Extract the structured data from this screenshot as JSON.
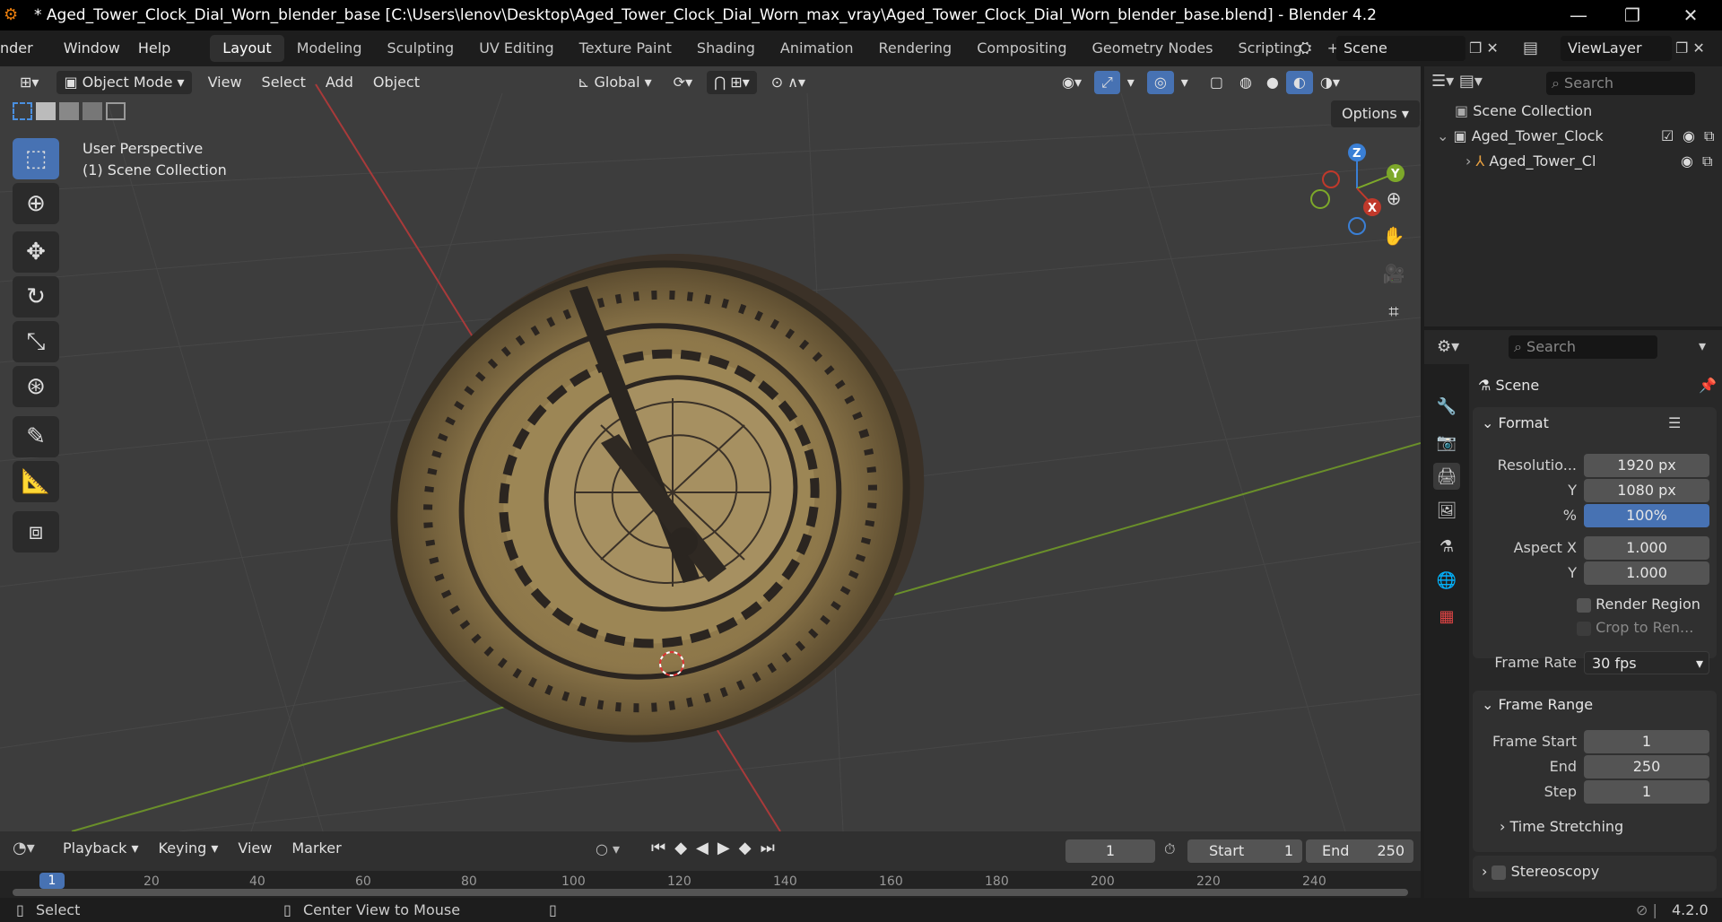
{
  "title_bar": {
    "title": "* Aged_Tower_Clock_Dial_Worn_blender_base [C:\\Users\\lenov\\Desktop\\Aged_Tower_Clock_Dial_Worn_max_vray\\Aged_Tower_Clock_Dial_Worn_blender_base.blend] - Blender 4.2",
    "minimize": "—",
    "maximize": "❐",
    "close": "✕"
  },
  "menu": {
    "items": [
      "nder",
      "Window",
      "Help"
    ],
    "workspaces": [
      "Layout",
      "Modeling",
      "Sculpting",
      "UV Editing",
      "Texture Paint",
      "Shading",
      "Animation",
      "Rendering",
      "Compositing",
      "Geometry Nodes",
      "Scripting"
    ],
    "active_workspace": "Layout",
    "add_tab": "+",
    "scene": "Scene",
    "view_layer": "ViewLayer"
  },
  "viewport": {
    "mode": "Object Mode",
    "menus": [
      "View",
      "Select",
      "Add",
      "Object"
    ],
    "transform_orientation": "Global",
    "options": "Options",
    "info_line1": "User Perspective",
    "info_line2": "(1) Scene Collection",
    "gizmo": {
      "x": "X",
      "y": "Y",
      "z": "Z"
    }
  },
  "outliner": {
    "search_placeholder": "Search",
    "root": "Scene Collection",
    "collection": "Aged_Tower_Clock",
    "object": "Aged_Tower_Cl"
  },
  "properties": {
    "search_placeholder": "Search",
    "context": "Scene",
    "format_panel": "Format",
    "resolution_label": "Resolutio...",
    "resolution_x": "1920 px",
    "y_label": "Y",
    "resolution_y": "1080 px",
    "percent_label": "%",
    "percent": "100%",
    "aspect_x_label": "Aspect X",
    "aspect_x": "1.000",
    "aspect_y_label": "Y",
    "aspect_y": "1.000",
    "render_region": "Render Region",
    "crop": "Crop to Ren...",
    "frame_rate_label": "Frame Rate",
    "frame_rate": "30 fps",
    "frame_range_panel": "Frame Range",
    "frame_start_label": "Frame Start",
    "frame_start": "1",
    "end_label": "End",
    "end": "250",
    "step_label": "Step",
    "step": "1",
    "time_stretching": "Time Stretching",
    "stereoscopy": "Stereoscopy"
  },
  "timeline": {
    "menus": [
      "Playback",
      "Keying",
      "View",
      "Marker"
    ],
    "current_frame": "1",
    "start_label": "Start",
    "start": "1",
    "end_label": "End",
    "end": "250",
    "ruler": [
      "1",
      "20",
      "40",
      "60",
      "80",
      "100",
      "120",
      "140",
      "160",
      "180",
      "200",
      "220",
      "240"
    ]
  },
  "status": {
    "select": "Select",
    "center_view": "Center View to Mouse",
    "version": "4.2.0"
  },
  "colors": {
    "accent": "#4772b3",
    "x_axis": "#c0392b",
    "y_axis": "#7da82a",
    "z_axis": "#3a7fd5"
  }
}
